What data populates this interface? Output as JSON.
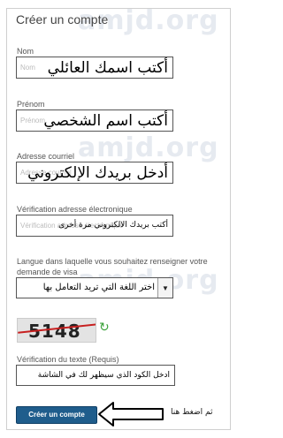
{
  "watermark": "amjd.org",
  "form": {
    "title": "Créer un compte",
    "fields": [
      {
        "label": "Nom",
        "placeholder": "Nom",
        "annotation": "أكتب اسمك العائلي"
      },
      {
        "label": "Prénom",
        "placeholder": "Prénom",
        "annotation": "أكتب اسم الشخصي"
      },
      {
        "label": "Adresse courriel",
        "placeholder": "Adresse courriel",
        "annotation": "أدخل بريدك الإلكتروني"
      },
      {
        "label": "Vérification adresse électronique",
        "placeholder": "Vérification adresse électronique",
        "annotation": "أكتب بريدك الالكتروني مرة أخرى"
      }
    ],
    "language": {
      "label": "Langue dans laquelle vous souhaitez renseigner votre demande de visa",
      "annotation": "اختر اللغة التي تريد التعامل بها"
    },
    "captcha": {
      "code": "5148"
    },
    "verification": {
      "label": "Vérification du texte (Requis)",
      "annotation": "ادخل الكود الذي سيظهر لك في الشاشة"
    },
    "submit_label": "Créer un compte",
    "click_hint": "ثم اضغط هنا"
  },
  "icons": {
    "dropdown": "chevron-down-icon",
    "refresh": "refresh-icon",
    "arrow": "arrow-left-icon"
  },
  "colors": {
    "button": "#1f5d8c",
    "captcha_line": "#c72020",
    "refresh": "#3aa13a"
  }
}
